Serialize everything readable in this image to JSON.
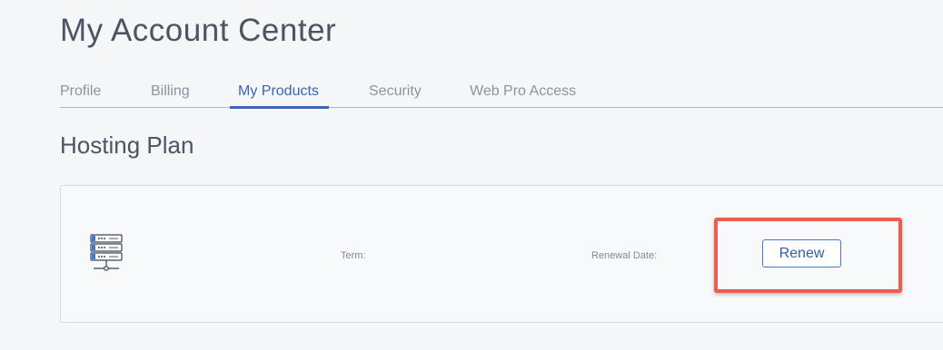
{
  "header": {
    "title": "My Account Center"
  },
  "tabs": [
    {
      "label": "Profile",
      "active": false
    },
    {
      "label": "Billing",
      "active": false
    },
    {
      "label": "My Products",
      "active": true
    },
    {
      "label": "Security",
      "active": false
    },
    {
      "label": "Web Pro Access",
      "active": false
    }
  ],
  "section": {
    "title": "Hosting Plan"
  },
  "product": {
    "icon": "server-rack-icon",
    "term_label": "Term:",
    "renewal_label": "Renewal Date:",
    "renew_button": "Renew"
  },
  "colors": {
    "accent": "#3a66b5",
    "highlight": "#ec5d4f",
    "background": "#f5f6f8"
  }
}
